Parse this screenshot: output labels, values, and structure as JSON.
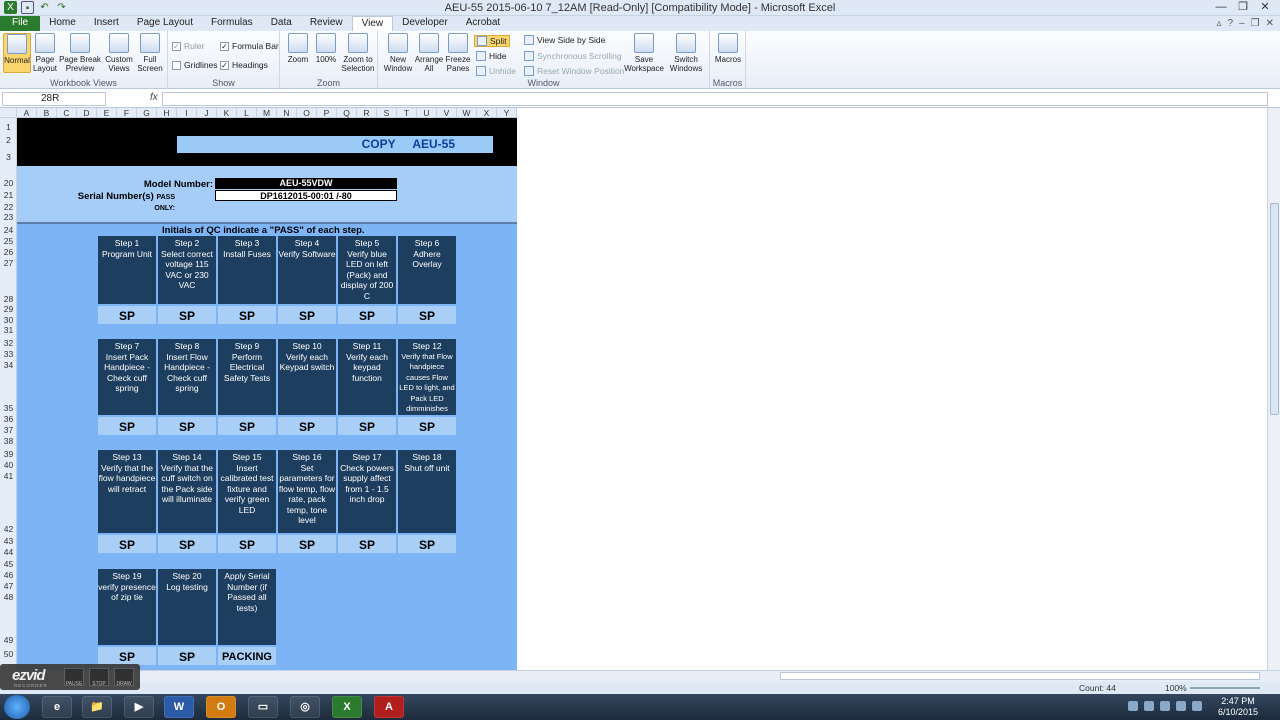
{
  "window": {
    "title": "AEU-55 2015-06-10 7_12AM  [Read-Only]  [Compatibility Mode]  -  Microsoft Excel"
  },
  "tabs": [
    "File",
    "Home",
    "Insert",
    "Page Layout",
    "Formulas",
    "Data",
    "Review",
    "View",
    "Developer",
    "Acrobat"
  ],
  "ribbon": {
    "workbook_views": {
      "label": "Workbook Views",
      "normal": "Normal",
      "page_layout": "Page Layout",
      "page_break": "Page Break Preview",
      "custom_views": "Custom Views",
      "full_screen": "Full Screen"
    },
    "show": {
      "label": "Show",
      "ruler": "Ruler",
      "formula_bar": "Formula Bar",
      "gridlines": "Gridlines",
      "headings": "Headings"
    },
    "zoom": {
      "label": "Zoom",
      "zoom": "Zoom",
      "hundred": "100%",
      "zoom_to_selection": "Zoom to Selection"
    },
    "window": {
      "label": "Window",
      "new_window": "New Window",
      "arrange_all": "Arrange All",
      "freeze_panes": "Freeze Panes",
      "split": "Split",
      "hide": "Hide",
      "unhide": "Unhide",
      "view_side": "View Side by Side",
      "sync_scroll": "Synchronous Scrolling",
      "reset_pos": "Reset Window Position",
      "save_workspace": "Save Workspace",
      "switch_windows": "Switch Windows"
    },
    "macros": {
      "label": "Macros",
      "macros": "Macros"
    }
  },
  "formula_bar": {
    "name_box": "28R",
    "fx": "fx"
  },
  "columns": [
    "A",
    "B",
    "C",
    "D",
    "E",
    "F",
    "G",
    "H",
    "I",
    "J",
    "K",
    "L",
    "M",
    "N",
    "O",
    "P",
    "Q",
    "R",
    "S",
    "T",
    "U",
    "V",
    "W",
    "X",
    "Y"
  ],
  "rows": [
    "1",
    "2",
    "3",
    "20",
    "21",
    "22",
    "23",
    "24",
    "25",
    "26",
    "27",
    "28",
    "29",
    "30",
    "31",
    "32",
    "33",
    "34",
    "35",
    "36",
    "37",
    "38",
    "39",
    "40",
    "41",
    "42",
    "43",
    "44",
    "45",
    "46",
    "47",
    "48",
    "49",
    "50"
  ],
  "sheet": {
    "copy_label": "COPY AEU-55",
    "model_label": "Model Number:",
    "model_value": "AEU-55VDW",
    "serial_label": "Serial Number(s)",
    "serial_sub": "PASS ONLY:",
    "serial_value": "DP1612015-00:01 /-80",
    "initials_note": "Initials of QC indicate a \"PASS\" of each step.",
    "steps": [
      {
        "title": "Step 1",
        "text": "Program Unit",
        "mark": "SP"
      },
      {
        "title": "Step 2",
        "text": "Select correct voltage 115 VAC or 230 VAC",
        "mark": "SP"
      },
      {
        "title": "Step 3",
        "text": "Install Fuses",
        "mark": "SP"
      },
      {
        "title": "Step 4",
        "text": "Verify Software",
        "mark": "SP"
      },
      {
        "title": "Step 5",
        "text": "Verify blue LED on left (Pack) and display of 200 C",
        "mark": "SP"
      },
      {
        "title": "Step 6",
        "text": "Adhere Overlay",
        "mark": "SP"
      },
      {
        "title": "Step 7",
        "text": "Insert Pack Handpiece - Check cuff spring",
        "mark": "SP"
      },
      {
        "title": "Step 8",
        "text": "Insert Flow Handpiece - Check cuff spring",
        "mark": "SP"
      },
      {
        "title": "Step 9",
        "text": "Perform Electrical Safety Tests",
        "mark": "SP"
      },
      {
        "title": "Step 10",
        "text": "Verify each Keypad switch",
        "mark": "SP"
      },
      {
        "title": "Step 11",
        "text": "Verify each keypad function",
        "mark": "SP"
      },
      {
        "title": "Step 12",
        "text": "Verify that Flow handpiece causes Flow LED to light, and Pack LED dimminishes",
        "mark": "SP"
      },
      {
        "title": "Step 13",
        "text": "Verify that the flow handpiece will retract",
        "mark": "SP"
      },
      {
        "title": "Step 14",
        "text": "Verify that the cuff switch on the Pack side will illuminate",
        "mark": "SP"
      },
      {
        "title": "Step 15",
        "text": "Insert calibrated test fixture and verify green LED",
        "mark": "SP"
      },
      {
        "title": "Step 16",
        "text": "Set parameters for flow temp, flow rate, pack temp, tone level",
        "mark": "SP"
      },
      {
        "title": "Step 17",
        "text": "Check powers supply affect from 1 - 1.5 inch drop",
        "mark": "SP"
      },
      {
        "title": "Step 18",
        "text": "Shut off unit",
        "mark": "SP"
      },
      {
        "title": "Step 19",
        "text": "verify presence of zip tie",
        "mark": "SP"
      },
      {
        "title": "Step 20",
        "text": "Log testing",
        "mark": "SP"
      },
      {
        "title": "",
        "text": "Apply Serial Number (if Passed all tests)",
        "mark": "PACKING"
      }
    ]
  },
  "status": {
    "count": "Count: 44",
    "zoom": "100%"
  },
  "recorder": {
    "logo": "ezvid",
    "sub": "RECORDER",
    "pause": "PAUSE",
    "stop": "STOP",
    "draw": "DRAW"
  },
  "taskbar": {
    "time": "2:47 PM",
    "date": "6/10/2015",
    "apps": [
      "e",
      "📁",
      "▶",
      "W",
      "O",
      "▭",
      "◎",
      "X",
      "A"
    ]
  }
}
